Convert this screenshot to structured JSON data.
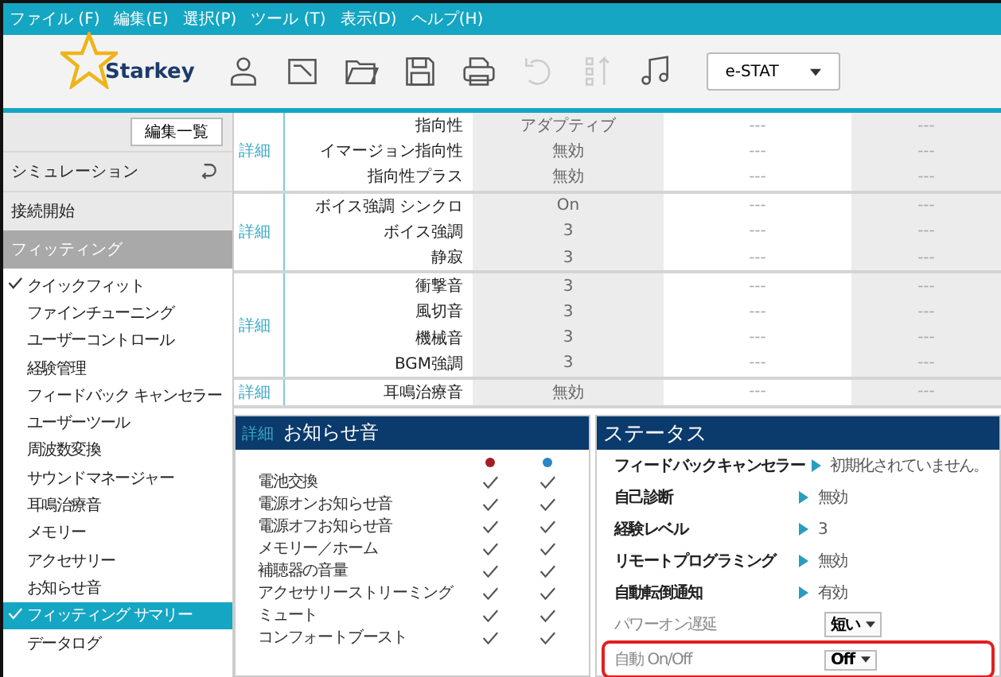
{
  "menu": [
    "ファイル (F)",
    "編集(E)",
    "選択(P)",
    "ツール (T)",
    "表示(D)",
    "ヘルプ(H)"
  ],
  "toolbar": {
    "logo": "Starkey",
    "buttons": [
      {
        "kind": "person",
        "disabled": false
      },
      {
        "kind": "window",
        "disabled": false
      },
      {
        "kind": "folder",
        "disabled": false
      },
      {
        "kind": "disk",
        "disabled": false
      },
      {
        "kind": "printer",
        "disabled": false
      },
      {
        "kind": "undo",
        "disabled": true
      },
      {
        "kind": "transfer",
        "disabled": true
      },
      {
        "kind": "music",
        "disabled": false
      }
    ],
    "dropdown": "e-STAT"
  },
  "sidebar": {
    "edit_button": "編集一覧",
    "links": [
      {
        "label": "シミュレーション",
        "kind": "refresh"
      },
      {
        "label": "接続開始",
        "kind": "plain"
      }
    ],
    "section": "フィッティング",
    "items": [
      {
        "label": "クイックフィット",
        "checked": true,
        "selected": false
      },
      {
        "label": "ファインチューニング",
        "checked": false,
        "selected": false
      },
      {
        "label": "ユーザーコントロール",
        "checked": false,
        "selected": false
      },
      {
        "label": "経験管理",
        "checked": false,
        "selected": false
      },
      {
        "label": "フィードバック キャンセラー",
        "checked": false,
        "selected": false
      },
      {
        "label": "ユーザーツール",
        "checked": false,
        "selected": false
      },
      {
        "label": "周波数変換",
        "checked": false,
        "selected": false
      },
      {
        "label": "サウンドマネージャー",
        "checked": false,
        "selected": false
      },
      {
        "label": "耳鳴治療音",
        "checked": false,
        "selected": false
      },
      {
        "label": "メモリー",
        "checked": false,
        "selected": false
      },
      {
        "label": "アクセサリー",
        "checked": false,
        "selected": false
      },
      {
        "label": "お知らせ音",
        "checked": false,
        "selected": false
      },
      {
        "label": "フィッティング サマリー",
        "checked": true,
        "selected": true
      },
      {
        "label": "データログ",
        "checked": false,
        "selected": false
      }
    ]
  },
  "settings_table": {
    "groups": [
      {
        "link": "詳細",
        "rows": [
          {
            "label": "指向性",
            "values": [
              "アダプティブ",
              "---",
              "---"
            ]
          },
          {
            "label": "イマージョン指向性",
            "values": [
              "無効",
              "---",
              "---"
            ]
          },
          {
            "label": "指向性プラス",
            "values": [
              "無効",
              "---",
              "---"
            ]
          }
        ]
      },
      {
        "link": "詳細",
        "rows": [
          {
            "label": "ボイス強調 シンクロ",
            "values": [
              "On",
              "---",
              "---"
            ]
          },
          {
            "label": "ボイス強調",
            "values": [
              "3",
              "---",
              "---"
            ]
          },
          {
            "label": "静寂",
            "values": [
              "3",
              "---",
              "---"
            ]
          }
        ]
      },
      {
        "link": "詳細",
        "rows": [
          {
            "label": "衝撃音",
            "values": [
              "3",
              "---",
              "---"
            ]
          },
          {
            "label": "風切音",
            "values": [
              "3",
              "---",
              "---"
            ]
          },
          {
            "label": "機械音",
            "values": [
              "3",
              "---",
              "---"
            ]
          },
          {
            "label": "BGM強調",
            "values": [
              "3",
              "---",
              "---"
            ]
          }
        ]
      },
      {
        "link": "詳細",
        "rows": [
          {
            "label": "耳鳴治療音",
            "values": [
              "無効",
              "---",
              "---"
            ]
          }
        ]
      }
    ]
  },
  "notifications": {
    "link": "詳細",
    "title": "お知らせ音",
    "columns": [
      {
        "color": "#a31f24"
      },
      {
        "color": "#2b86c5"
      }
    ],
    "rows": [
      {
        "label": "電池交換",
        "checks": [
          {
            "checked": true
          },
          {
            "checked": true
          }
        ]
      },
      {
        "label": "電源オンお知らせ音",
        "checks": [
          {
            "checked": true
          },
          {
            "checked": true
          }
        ]
      },
      {
        "label": "電源オフお知らせ音",
        "checks": [
          {
            "checked": true
          },
          {
            "checked": true
          }
        ]
      },
      {
        "label": "メモリー／ホーム",
        "checks": [
          {
            "checked": true
          },
          {
            "checked": true
          }
        ]
      },
      {
        "label": "補聴器の音量",
        "checks": [
          {
            "checked": true
          },
          {
            "checked": true
          }
        ]
      },
      {
        "label": "アクセサリーストリーミング",
        "checks": [
          {
            "checked": true
          },
          {
            "checked": true
          }
        ]
      },
      {
        "label": "ミュート",
        "checks": [
          {
            "checked": true
          },
          {
            "checked": true
          }
        ]
      },
      {
        "label": "コンフォートブースト",
        "checks": [
          {
            "checked": true
          },
          {
            "checked": true
          }
        ]
      }
    ]
  },
  "status": {
    "title": "ステータス",
    "rows": [
      {
        "kind": "info",
        "label": "フィードバックキャンセラー",
        "value": "初期化されていません。",
        "highlighted": false
      },
      {
        "kind": "info",
        "label": "自己診断",
        "value": "無効",
        "highlighted": false
      },
      {
        "kind": "info",
        "label": "経験レベル",
        "value": "3",
        "highlighted": false
      },
      {
        "kind": "info",
        "label": "リモートプログラミング",
        "value": "無効",
        "highlighted": false
      },
      {
        "kind": "info",
        "label": "自動転倒通知",
        "value": "有効",
        "highlighted": false
      },
      {
        "kind": "dropdown",
        "label": "パワーオン遅延",
        "value": "短い",
        "highlighted": false
      },
      {
        "kind": "dropdown",
        "label": "自動 On/Off",
        "value": "Off",
        "highlighted": true
      }
    ]
  }
}
